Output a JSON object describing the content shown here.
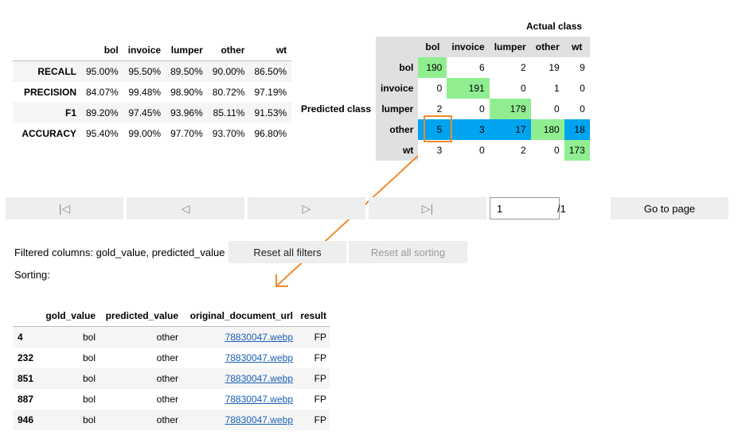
{
  "metrics": {
    "columns": [
      "bol",
      "invoice",
      "lumper",
      "other",
      "wt"
    ],
    "rows": [
      {
        "label": "RECALL",
        "values": [
          "95.00%",
          "95.50%",
          "89.50%",
          "90.00%",
          "86.50%"
        ]
      },
      {
        "label": "PRECISION",
        "values": [
          "84.07%",
          "99.48%",
          "98.90%",
          "80.72%",
          "97.19%"
        ]
      },
      {
        "label": "F1",
        "values": [
          "89.20%",
          "97.45%",
          "93.96%",
          "85.11%",
          "91.53%"
        ]
      },
      {
        "label": "ACCURACY",
        "values": [
          "95.40%",
          "99.00%",
          "97.70%",
          "93.70%",
          "96.80%"
        ]
      }
    ]
  },
  "confusion": {
    "actual_label": "Actual class",
    "predicted_label": "Predicted class",
    "columns": [
      "bol",
      "invoice",
      "lumper",
      "other",
      "wt"
    ],
    "rows": [
      {
        "label": "bol",
        "values": [
          "190",
          "6",
          "2",
          "19",
          "9"
        ]
      },
      {
        "label": "invoice",
        "values": [
          "0",
          "191",
          "0",
          "1",
          "0"
        ]
      },
      {
        "label": "lumper",
        "values": [
          "2",
          "0",
          "179",
          "0",
          "0"
        ]
      },
      {
        "label": "other",
        "values": [
          "5",
          "3",
          "17",
          "180",
          "18"
        ]
      },
      {
        "label": "wt",
        "values": [
          "3",
          "0",
          "2",
          "0",
          "173"
        ]
      }
    ],
    "highlight_color": "#00a4ef",
    "diagonal_color": "#90ee90"
  },
  "annotation_color": "#f08a2c",
  "pager": {
    "first_icon": "|◁",
    "prev_icon": "◁",
    "next_icon": "▷",
    "last_icon": "▷|",
    "page_value": "1",
    "page_total": "/1",
    "goto_label": "Go to page"
  },
  "filters": {
    "filtered_text": "Filtered columns: gold_value, predicted_value",
    "sorting_text": "Sorting:",
    "reset_filters_label": "Reset all filters",
    "reset_sorting_label": "Reset all sorting"
  },
  "results": {
    "columns": [
      "",
      "gold_value",
      "predicted_value",
      "original_document_url",
      "result"
    ],
    "rows": [
      {
        "index": "4",
        "gold": "bol",
        "predicted": "other",
        "url": "78830047.webp",
        "result": "FP"
      },
      {
        "index": "232",
        "gold": "bol",
        "predicted": "other",
        "url": "78830047.webp",
        "result": "FP"
      },
      {
        "index": "851",
        "gold": "bol",
        "predicted": "other",
        "url": "78830047.webp",
        "result": "FP"
      },
      {
        "index": "887",
        "gold": "bol",
        "predicted": "other",
        "url": "78830047.webp",
        "result": "FP"
      },
      {
        "index": "946",
        "gold": "bol",
        "predicted": "other",
        "url": "78830047.webp",
        "result": "FP"
      }
    ]
  }
}
